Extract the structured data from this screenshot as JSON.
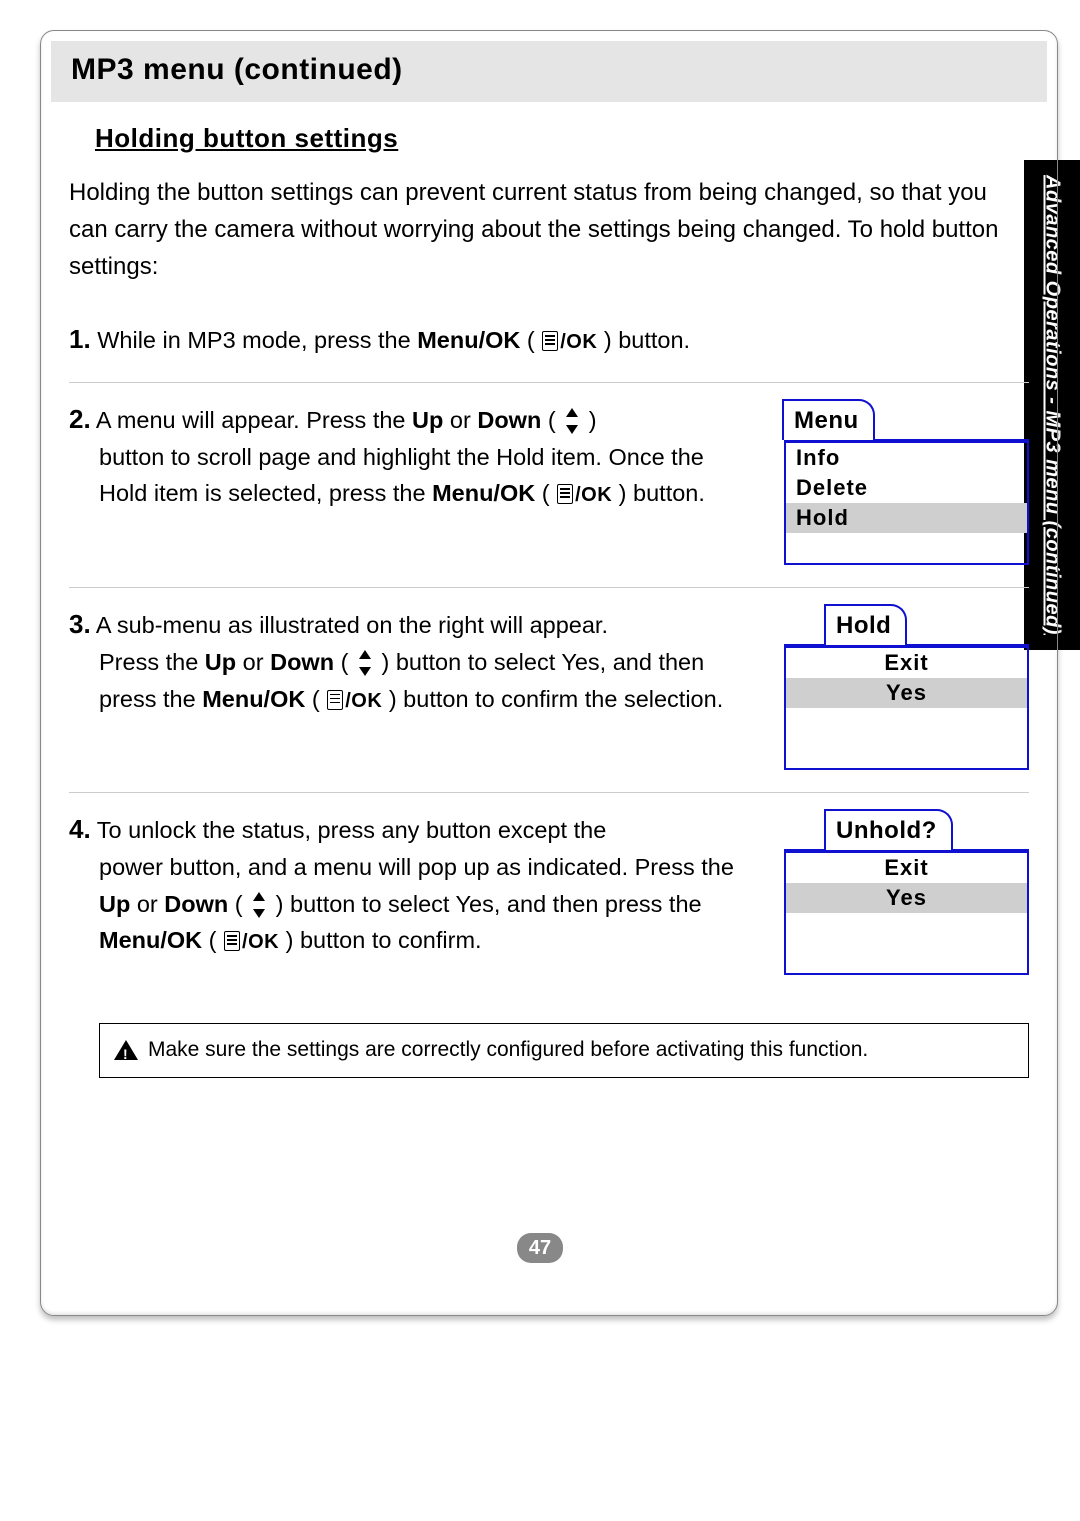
{
  "header": {
    "title": "MP3 menu (continued)"
  },
  "section": {
    "subhead": "Holding button settings"
  },
  "intro": "Holding the button settings can prevent current status from being changed, so that you can carry the camera without worrying about the settings being changed. To hold button settings:",
  "steps": {
    "s1": {
      "num": "1.",
      "a": " While in MP3 mode, press the ",
      "b": "Menu/OK",
      "c": " button."
    },
    "s2": {
      "num": "2.",
      "a": " A menu will appear. Press the ",
      "b": "Up",
      "c": " or ",
      "d": "Down",
      "e": "button to scroll page and highlight the Hold item. Once the Hold item is selected, press the ",
      "f": "Menu/OK",
      "g": " button."
    },
    "s3": {
      "num": "3.",
      "a": " A sub-menu as illustrated on the right will appear.",
      "b": "Press the ",
      "c": "Up",
      "d": " or ",
      "e": "Down",
      "f": " button to select Yes, and then press the ",
      "g": "Menu/OK",
      "h": " button to confirm the selection."
    },
    "s4": {
      "num": "4.",
      "a": " To unlock the status, press any button except the",
      "b": "power button, and a menu will pop up as indicated. Press the ",
      "c": "Up",
      "d": " or ",
      "e": "Down",
      "f": " button to select Yes, and then press the ",
      "g": "Menu/OK",
      "h": " button to confirm."
    }
  },
  "lcd2": {
    "tab": "Menu",
    "i1": "Info",
    "i2": "Delete",
    "i3": "Hold"
  },
  "lcd3": {
    "tab": "Hold",
    "i1": "Exit",
    "i2": "Yes"
  },
  "lcd4": {
    "tab": "Unhold?",
    "i1": "Exit",
    "i2": "Yes"
  },
  "caution": "Make sure the settings are correctly configured before activating this function.",
  "sidetab": "Advanced Operations - MP3 menu (continued)",
  "icons": {
    "ok": "/OK"
  },
  "pagenum": "47"
}
